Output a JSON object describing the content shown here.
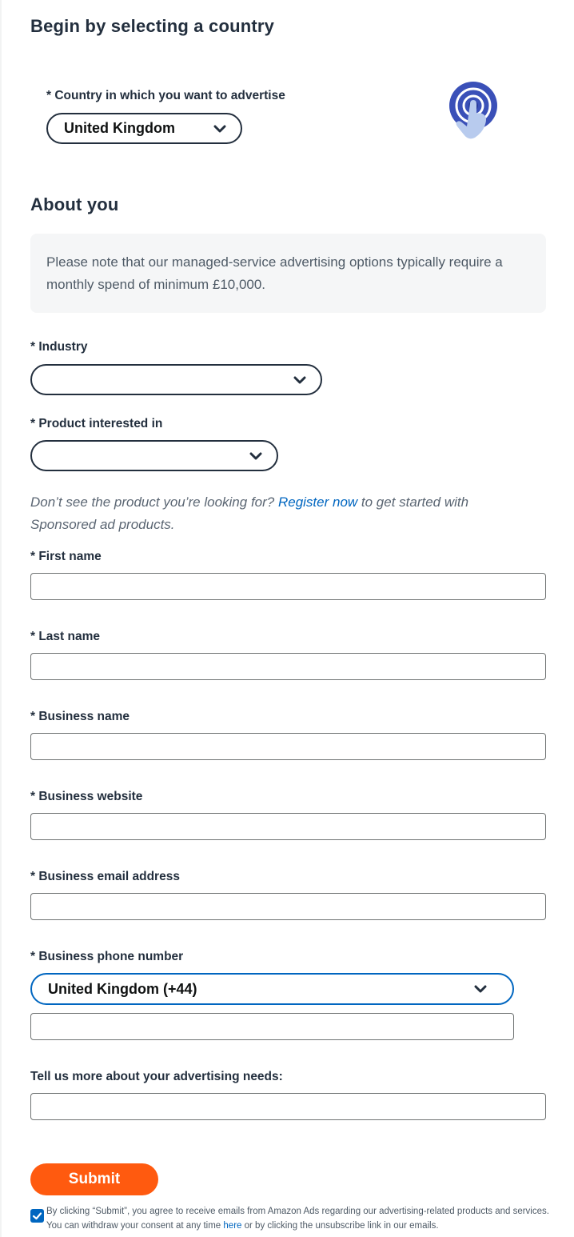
{
  "country_section": {
    "title": "Begin by selecting a country",
    "country_label": "* Country in which you want to advertise",
    "country_value": "United Kingdom"
  },
  "about_section": {
    "title": "About you",
    "notice": "Please note that our managed-service advertising options typically require a monthly spend of minimum £10,000."
  },
  "fields": {
    "industry_label": "* Industry",
    "industry_value": "",
    "product_label": "* Product interested in",
    "product_value": "",
    "product_note_before": "Don’t see the product you’re looking for? ",
    "product_note_link": "Register now",
    "product_note_after": " to get started with Sponsored ad products.",
    "first_name_label": "* First name",
    "first_name_value": "",
    "last_name_label": "* Last name",
    "last_name_value": "",
    "business_name_label": "* Business name",
    "business_name_value": "",
    "business_website_label": "* Business website",
    "business_website_value": "",
    "business_email_label": "* Business email address",
    "business_email_value": "",
    "phone_label": "* Business phone number",
    "phone_country_value": "United Kingdom (+44)",
    "phone_value": "",
    "needs_label": "Tell us more about your advertising needs:",
    "needs_value": ""
  },
  "submit": {
    "label": "Submit"
  },
  "consent": {
    "checked": true,
    "text_before": "By clicking “Submit”, you agree to receive emails from Amazon Ads regarding our advertising-related products and services. You can withdraw your consent at any time ",
    "link": "here",
    "text_after": " or by clicking the unsubscribe link in our emails."
  },
  "colors": {
    "accent_orange": "#ff5a0f",
    "link_blue": "#0066c0",
    "icon_blue": "#3a50b8",
    "text_dark": "#232f3e"
  }
}
